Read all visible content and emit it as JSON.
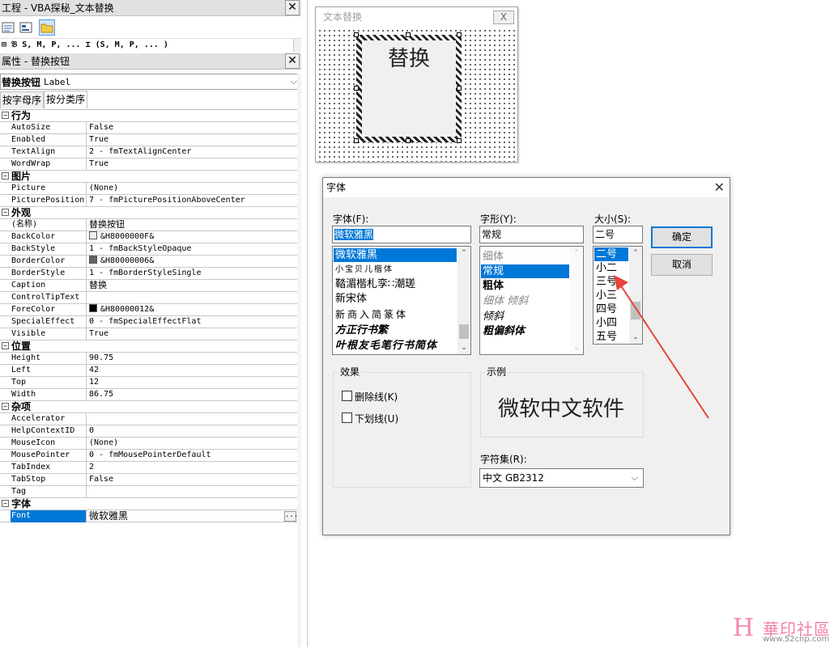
{
  "project_window": {
    "title": "工程 - VBA探秘_文本替换",
    "tree_partial": "⊞ 𝔅 S, M, P, ... ⌶ (S, M, P, ... )"
  },
  "properties_window": {
    "title": "属性 - 替换按钮",
    "object_select": "替换按钮",
    "object_type": "Label",
    "tabs": [
      "按字母序",
      "按分类序"
    ],
    "categories": [
      {
        "name": "行为",
        "props": [
          [
            "AutoSize",
            "False"
          ],
          [
            "Enabled",
            "True"
          ],
          [
            "TextAlign",
            "2 - fmTextAlignCenter"
          ],
          [
            "WordWrap",
            "True"
          ]
        ]
      },
      {
        "name": "图片",
        "props": [
          [
            "Picture",
            "(None)"
          ],
          [
            "PicturePosition",
            "7 - fmPicturePositionAboveCenter"
          ]
        ]
      },
      {
        "name": "外观",
        "props": [
          [
            "(名称)",
            "替换按钮"
          ],
          [
            "BackColor",
            "&H8000000F&"
          ],
          [
            "BackStyle",
            "1 - fmBackStyleOpaque"
          ],
          [
            "BorderColor",
            "&H80000006&"
          ],
          [
            "BorderStyle",
            "1 - fmBorderStyleSingle"
          ],
          [
            "Caption",
            "替换"
          ],
          [
            "ControlTipText",
            ""
          ],
          [
            "ForeColor",
            "&H80000012&"
          ],
          [
            "SpecialEffect",
            "0 - fmSpecialEffectFlat"
          ],
          [
            "Visible",
            "True"
          ]
        ]
      },
      {
        "name": "位置",
        "props": [
          [
            "Height",
            "90.75"
          ],
          [
            "Left",
            "42"
          ],
          [
            "Top",
            "12"
          ],
          [
            "Width",
            "86.75"
          ]
        ]
      },
      {
        "name": "杂项",
        "props": [
          [
            "Accelerator",
            ""
          ],
          [
            "HelpContextID",
            "0"
          ],
          [
            "MouseIcon",
            "(None)"
          ],
          [
            "MousePointer",
            "0 - fmMousePointerDefault"
          ],
          [
            "TabIndex",
            "2"
          ],
          [
            "TabStop",
            "False"
          ],
          [
            "Tag",
            ""
          ]
        ]
      },
      {
        "name": "字体",
        "props": [
          [
            "Font",
            "微软雅黑"
          ]
        ]
      }
    ],
    "colors": {
      "BackColor": "#f0f0f0",
      "BorderColor": "#646464",
      "ForeColor": "#000000"
    }
  },
  "userform": {
    "title": "文本替换",
    "close_label": "X",
    "label_caption": "替换"
  },
  "font_dialog": {
    "title": "字体",
    "font_label": "字体(F):",
    "font_value": "微软雅黑",
    "font_list": [
      "微软雅黑",
      "小宝贝儿楷体",
      "鞜湄楷札孪∷潮瑳",
      "新宋体",
      "新商入简篆体",
      "方正行书繁",
      "叶根友毛笔行书简体"
    ],
    "style_label": "字形(Y):",
    "style_value": "常规",
    "style_list": [
      "细体",
      "常规",
      "粗体",
      "细体 倾斜",
      "倾斜",
      "粗偏斜体"
    ],
    "size_label": "大小(S):",
    "size_value": "二号",
    "size_list": [
      "二号",
      "小二",
      "三号",
      "小三",
      "四号",
      "小四",
      "五号"
    ],
    "ok_label": "确定",
    "cancel_label": "取消",
    "effects_label": "效果",
    "strikeout_label": "删除线(K)",
    "underline_label": "下划线(U)",
    "sample_label": "示例",
    "sample_text": "微软中文软件",
    "charset_label": "字符集(R):",
    "charset_value": "中文 GB2312"
  },
  "annotation": {
    "color": "#e8453c"
  },
  "watermark": {
    "logo": "H",
    "title": "華印社區",
    "url": "www.52cnp.com",
    "color": "#f26b9e"
  }
}
